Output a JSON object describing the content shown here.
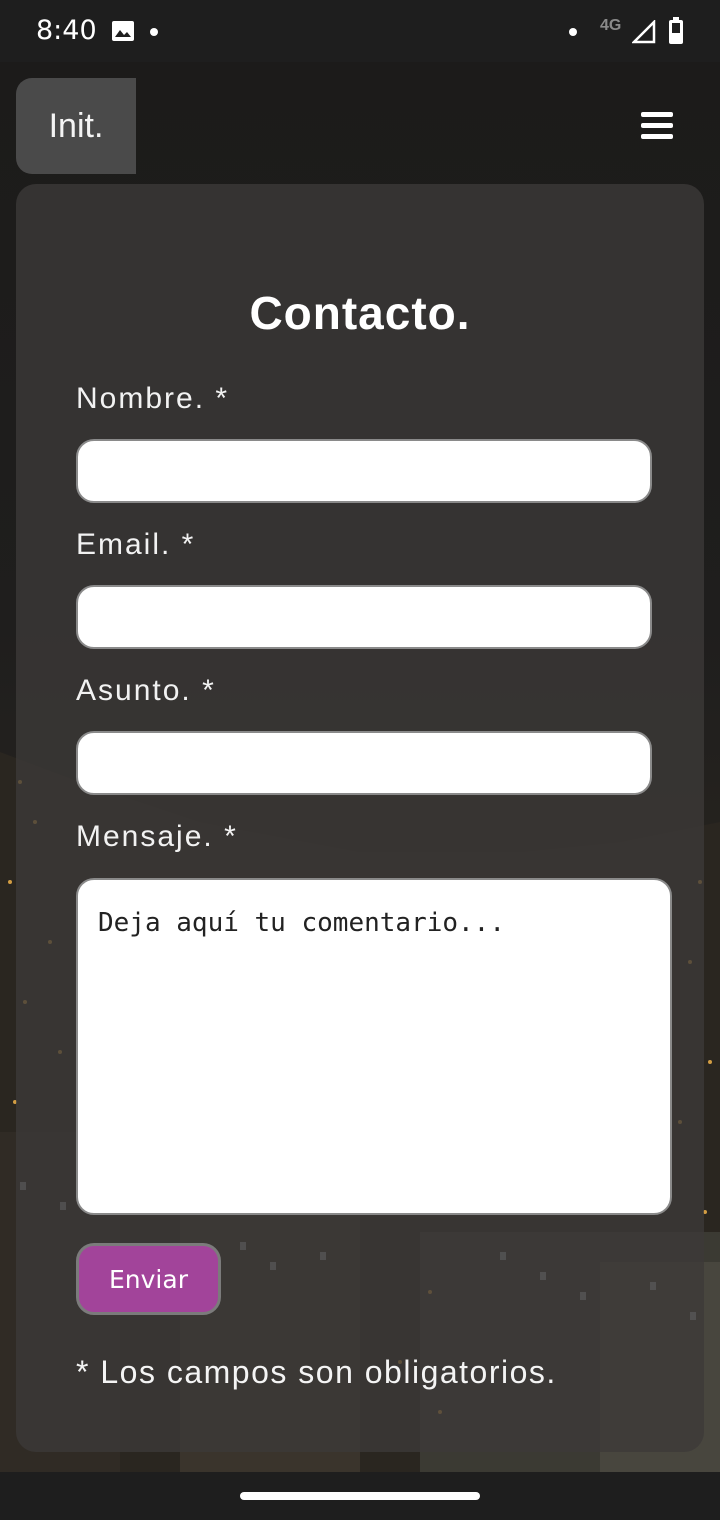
{
  "status_bar": {
    "time": "8:40",
    "network": "4G",
    "icons": [
      "gallery-icon",
      "notification-dot-icon",
      "signal-icon",
      "battery-icon"
    ]
  },
  "header": {
    "logo_text": "Init.",
    "menu_icon": "hamburger-menu-icon"
  },
  "form": {
    "title": "Contacto.",
    "fields": [
      {
        "label": "Nombre. *",
        "value": "",
        "placeholder": ""
      },
      {
        "label": "Email. *",
        "value": "",
        "placeholder": ""
      },
      {
        "label": "Asunto. *",
        "value": "",
        "placeholder": ""
      }
    ],
    "message": {
      "label": "Mensaje. *",
      "placeholder": "Deja aquí tu comentario..."
    },
    "submit_label": "Enviar",
    "required_note": "* Los campos son obligatorios."
  },
  "colors": {
    "accent_button": "#a2449a",
    "card_bg": "#3c3a39",
    "logo_bg": "#4a4a4a"
  }
}
